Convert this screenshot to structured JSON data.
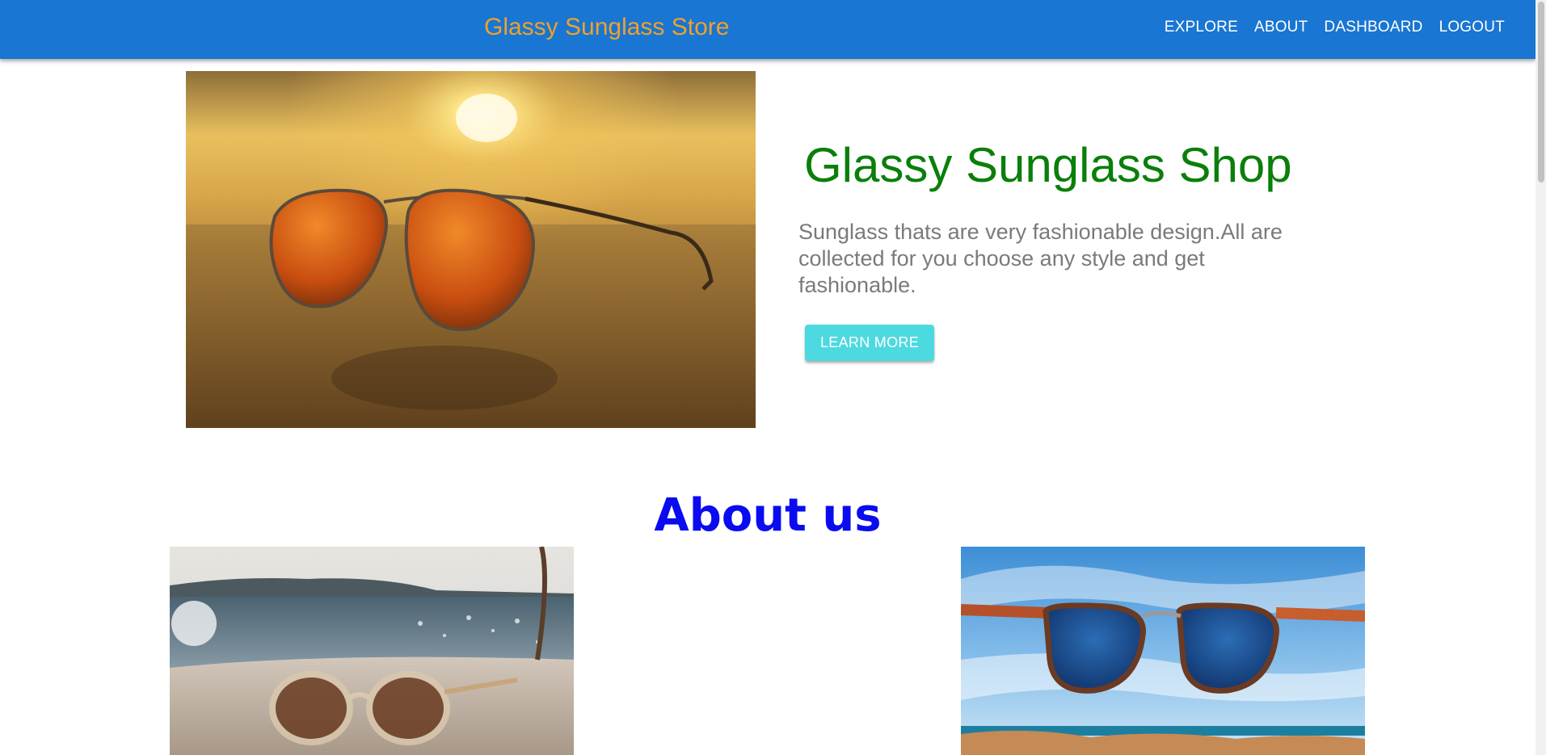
{
  "header": {
    "brand": "Glassy Sunglass Store",
    "nav": [
      {
        "label": "EXPLORE"
      },
      {
        "label": "ABOUT"
      },
      {
        "label": "DASHBOARD"
      },
      {
        "label": "LOGOUT"
      }
    ]
  },
  "hero": {
    "title": "Glassy Sunglass Shop",
    "description": "Sunglass thats are very fashionable design.All are collected for you choose any style and get fashionable.",
    "button_label": "LEARN MORE"
  },
  "about": {
    "title": "About us"
  },
  "colors": {
    "appbar": "#1976d2",
    "brand": "#f0a02e",
    "hero_title": "#0a7f0a",
    "about_title": "#0b0bf0",
    "button": "#4dd9e0"
  },
  "icons": [
    "sunglasses-beach-photo",
    "clear-sunglasses-photo",
    "blue-sunglasses-photo"
  ]
}
